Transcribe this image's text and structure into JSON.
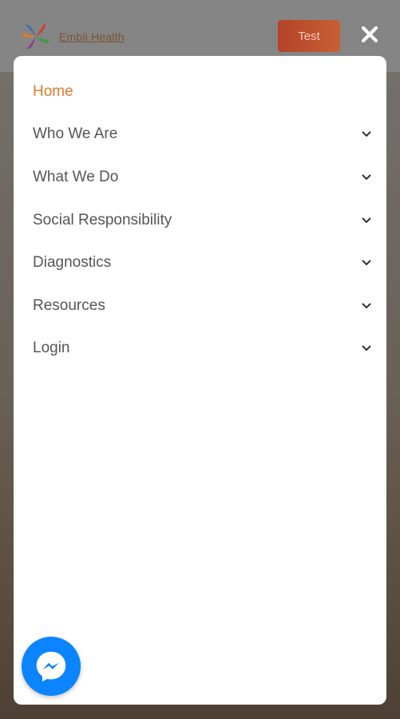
{
  "header": {
    "brand_name": "Embli Health",
    "test_button_label": "Test"
  },
  "menu": {
    "items": [
      {
        "label": "Home",
        "active": true,
        "has_dropdown": false
      },
      {
        "label": "Who We Are",
        "active": false,
        "has_dropdown": true
      },
      {
        "label": "What We Do",
        "active": false,
        "has_dropdown": true
      },
      {
        "label": "Social Responsibility",
        "active": false,
        "has_dropdown": true
      },
      {
        "label": "Diagnostics",
        "active": false,
        "has_dropdown": true
      },
      {
        "label": "Resources",
        "active": false,
        "has_dropdown": true
      },
      {
        "label": "Login",
        "active": false,
        "has_dropdown": true
      }
    ]
  },
  "icons": {
    "close": "close-icon",
    "chevron": "chevron-down-icon",
    "messenger": "messenger-icon"
  },
  "colors": {
    "active_menu": "#e07a2e",
    "menu_text": "#555555",
    "messenger_blue": "#0a84ff",
    "test_button": "#c05030"
  }
}
